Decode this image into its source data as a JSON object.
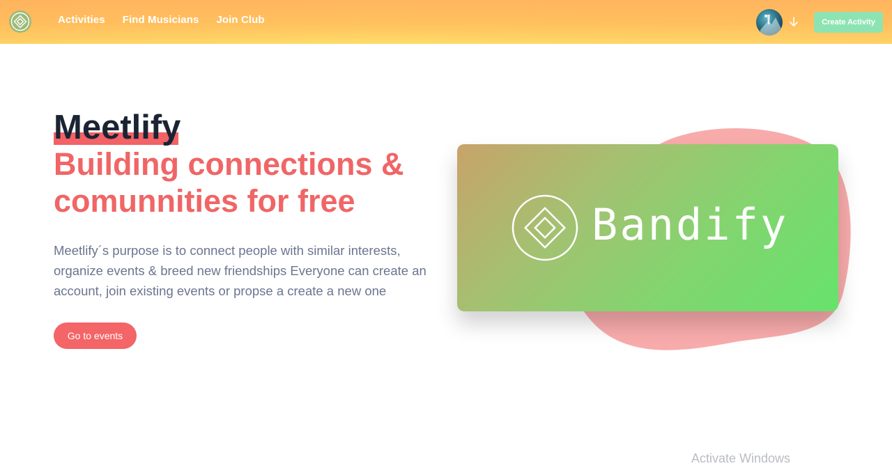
{
  "header": {
    "nav": [
      "Activities",
      "Find Musicians",
      "Join Club"
    ],
    "create_button": "Create Activity",
    "logo_icon": "diamond-logo-icon",
    "avatar_icon": "user-avatar",
    "chevron_icon": "arrow-down-icon"
  },
  "hero": {
    "brand": "Meetlify",
    "headline": "Building connections & comunnities for free",
    "description": "Meetlify´s purpose is to connect people with similar interests, organize events & breed new friendships Everyone can create an account, join existing events or propse a create a new one",
    "cta": "Go to events"
  },
  "card": {
    "title": "Bandify",
    "logo_icon": "diamond-logo-icon"
  },
  "system": {
    "watermark": "Activate Windows"
  },
  "colors": {
    "accent": "#f36567",
    "header_gradient": [
      "#ffb55f",
      "#ffdc6a"
    ],
    "card_gradient": [
      "#c8a36a",
      "#66e36c"
    ],
    "create_button": "#8ee3b2",
    "heading_dark": "#1a2433"
  }
}
